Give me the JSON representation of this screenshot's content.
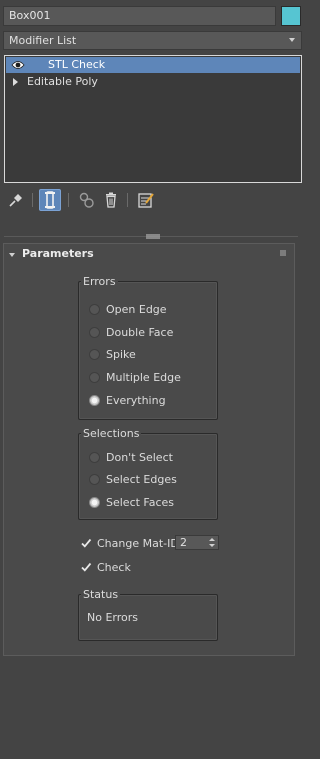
{
  "object": {
    "name": "Box001",
    "color": "#56c5d2"
  },
  "modifier_list": {
    "label": "Modifier List"
  },
  "stack": {
    "items": [
      {
        "label": "STL Check",
        "selected": true,
        "icon": "eye-icon"
      },
      {
        "label": "Editable Poly",
        "selected": false,
        "icon": "expand-triangle-icon"
      }
    ]
  },
  "toolbar": {
    "icons": [
      "pin-stack-icon",
      "show-end-result-icon",
      "make-unique-icon",
      "remove-modifier-icon",
      "configure-modifier-sets-icon"
    ],
    "active": "show-end-result-icon"
  },
  "parameters": {
    "title": "Parameters",
    "errors": {
      "title": "Errors",
      "options": [
        "Open Edge",
        "Double Face",
        "Spike",
        "Multiple Edge",
        "Everything"
      ],
      "selected": "Everything"
    },
    "selections": {
      "title": "Selections",
      "options": [
        "Don't Select",
        "Select Edges",
        "Select Faces"
      ],
      "selected": "Select Faces"
    },
    "change_mat_id": {
      "label": "Change Mat-ID",
      "checked": true,
      "value": "2"
    },
    "check": {
      "label": "Check",
      "checked": true
    },
    "status": {
      "title": "Status",
      "text": "No Errors"
    }
  },
  "colors": {
    "selection": "#5e86b9",
    "panel": "#444444"
  }
}
